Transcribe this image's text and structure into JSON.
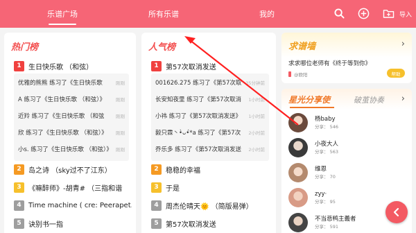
{
  "topbar": {
    "tabs": [
      {
        "label": "乐谱广场",
        "active": true
      },
      {
        "label": "所有乐谱",
        "active": false
      },
      {
        "label": "我的",
        "active": false
      }
    ],
    "import_label": "导入",
    "accent_color": "#f66576"
  },
  "hot": {
    "title": "热门榜",
    "first": {
      "rank": "1",
      "title": "生日快乐歌 （和弦）"
    },
    "practice": [
      {
        "text": "优雅的熊熊 练习了《生日快乐歌",
        "time": "刚刚"
      },
      {
        "text": "A 练习了《生日快乐歌 （和弦）》",
        "time": "刚刚"
      },
      {
        "text": "近羚 练习了《生日快乐歌 （和弦",
        "time": "刚刚"
      },
      {
        "text": "欣 练习了《生日快乐歌 （和弦）》",
        "time": "刚刚"
      },
      {
        "text": "小s. 练习了《生日快乐歌 （和弦）》",
        "time": "刚刚"
      }
    ],
    "rest": [
      {
        "rank": "2",
        "title": "岛之诗 （sky过不了江东）"
      },
      {
        "rank": "3",
        "title": "《嘛醉师》-胡青# （三指和谐"
      },
      {
        "rank": "4",
        "title": "Time machine ( cre: Peerapet..."
      },
      {
        "rank": "5",
        "title": "诀别书一指"
      }
    ]
  },
  "popular": {
    "title": "人气榜",
    "first": {
      "rank": "1",
      "title": "第57次取消发送"
    },
    "practice": [
      {
        "text": "001626.275 练习了《第57次取",
        "time": "35分钟前"
      },
      {
        "text": "长安知夜里 练习了《第57次取消",
        "time": "1小时前"
      },
      {
        "text": "小祎 练习了《第57次取消发送》",
        "time": "1小时前"
      },
      {
        "text": "毅只霖丶•̀ᴗ•́*a 练习了《第57次",
        "time": "2小时前"
      },
      {
        "text": "乔乐多 练习了《第57次取消发送",
        "time": "2小时前"
      }
    ],
    "rest": [
      {
        "rank": "2",
        "title": "稳稳的幸福"
      },
      {
        "rank": "3",
        "title": "于是"
      },
      {
        "rank": "4",
        "title": "周杰伦晴天🌞 （简版易弹）"
      },
      {
        "rank": "5",
        "title": "第57次取消发送"
      }
    ]
  },
  "request": {
    "title": "求谱墙",
    "message": "求求哪位老师有《终于等到你》",
    "user": "@欧阳",
    "help_label": "帮助"
  },
  "stars": {
    "tab_active": "星光分享使",
    "tab_other": "破茧协奏",
    "share_label": "分享：",
    "list": [
      {
        "name": "杨baby",
        "shares": "546"
      },
      {
        "name": "小夜大人",
        "shares": "563"
      },
      {
        "name": "维恩",
        "shares": "70"
      },
      {
        "name": "zyy·",
        "shares": "95"
      },
      {
        "name": "不当悲鸭主義者",
        "shares": "591"
      }
    ]
  }
}
